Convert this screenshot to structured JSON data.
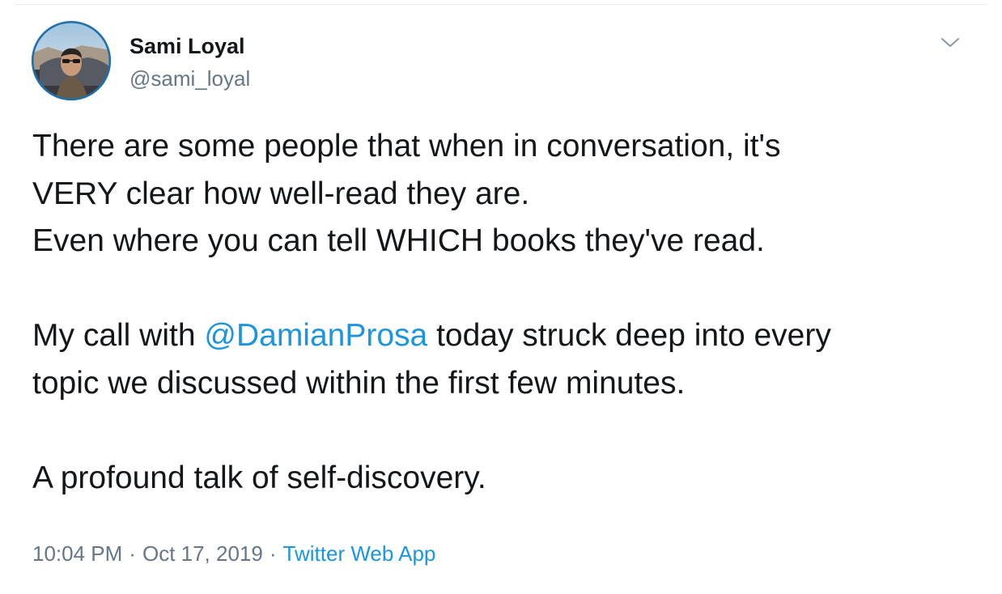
{
  "user": {
    "display_name": "Sami Loyal",
    "handle": "@sami_loyal",
    "avatar_icon": "profile-photo"
  },
  "menu": {
    "icon": "chevron-down-icon"
  },
  "tweet": {
    "lines": [
      "There are some people that when in conversation, it's",
      "VERY clear how well-read they are.",
      "Even where you can tell WHICH books they've read."
    ],
    "para2_before": "My call with ",
    "mention": "@DamianProsa",
    "para2_after": " today struck deep into every\ntopic we discussed within the first few minutes.",
    "para3": "A profound talk of self-discovery."
  },
  "meta": {
    "time": "10:04 PM",
    "date": "Oct 17, 2019",
    "separator": "·",
    "source": "Twitter Web App"
  },
  "colors": {
    "link": "#1b95e0",
    "text": "#14171a",
    "secondary": "#657786",
    "divider": "#e6ecf0"
  }
}
